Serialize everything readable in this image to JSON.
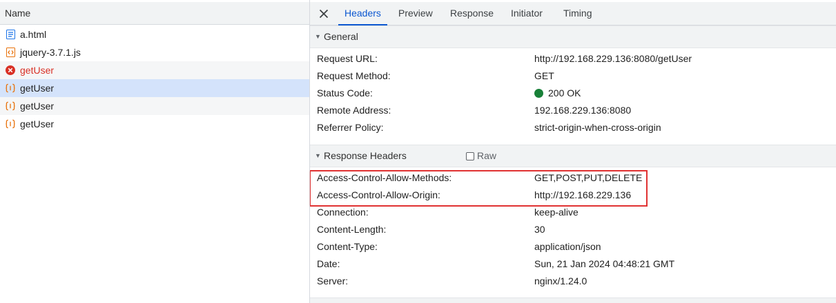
{
  "left_panel": {
    "column_header": "Name",
    "files": [
      {
        "name": "a.html",
        "icon": "document-icon",
        "state": "normal"
      },
      {
        "name": "jquery-3.7.1.js",
        "icon": "script-icon",
        "state": "normal"
      },
      {
        "name": "getUser",
        "icon": "error-icon",
        "state": "error"
      },
      {
        "name": "getUser",
        "icon": "fetch-icon",
        "state": "selected"
      },
      {
        "name": "getUser",
        "icon": "fetch-icon",
        "state": "normal"
      },
      {
        "name": "getUser",
        "icon": "fetch-icon",
        "state": "normal"
      }
    ]
  },
  "tabs": {
    "close_icon": "close-icon",
    "items": [
      {
        "label": "Headers",
        "active": true
      },
      {
        "label": "Preview",
        "active": false
      },
      {
        "label": "Response",
        "active": false
      },
      {
        "label": "Initiator",
        "active": false
      },
      {
        "label": "Timing",
        "active": false
      }
    ]
  },
  "general": {
    "title": "General",
    "rows": [
      {
        "key": "Request URL:",
        "value": "http://192.168.229.136:8080/getUser"
      },
      {
        "key": "Request Method:",
        "value": "GET"
      },
      {
        "key": "Status Code:",
        "value": "200 OK",
        "indicator": "green-status-dot"
      },
      {
        "key": "Remote Address:",
        "value": "192.168.229.136:8080"
      },
      {
        "key": "Referrer Policy:",
        "value": "strict-origin-when-cross-origin"
      }
    ]
  },
  "response_headers": {
    "title": "Response Headers",
    "raw_label": "Raw",
    "raw_checked": false,
    "rows": [
      {
        "key": "Access-Control-Allow-Methods:",
        "value": "GET,POST,PUT,DELETE"
      },
      {
        "key": "Access-Control-Allow-Origin:",
        "value": "http://192.168.229.136"
      },
      {
        "key": "Connection:",
        "value": "keep-alive"
      },
      {
        "key": "Content-Length:",
        "value": "30"
      },
      {
        "key": "Content-Type:",
        "value": "application/json"
      },
      {
        "key": "Date:",
        "value": "Sun, 21 Jan 2024 04:48:21 GMT"
      },
      {
        "key": "Server:",
        "value": "nginx/1.24.0"
      }
    ]
  },
  "colors": {
    "accent": "#0b57d0",
    "error": "#d93025",
    "status_ok": "#188038",
    "highlight_border": "#e03131",
    "selected_row": "#d4e3fb"
  }
}
